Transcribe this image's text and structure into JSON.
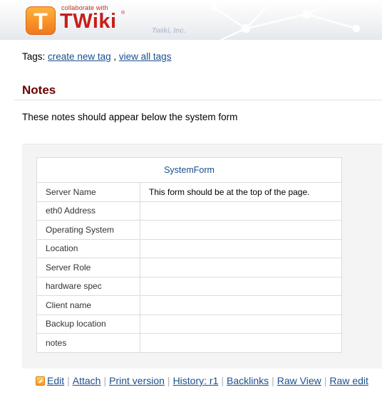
{
  "header": {
    "logo_letter": "T",
    "logo_tagline": "collaborate with",
    "logo_word": "TWiki",
    "logo_reg": "®",
    "company": "Twiki, Inc."
  },
  "tags": {
    "label": "Tags:",
    "create_new": "create new tag",
    "separator": ",",
    "view_all": "view all tags"
  },
  "notes": {
    "heading": "Notes",
    "text": "These notes should appear below the system form"
  },
  "system_form": {
    "title": "SystemForm",
    "rows": [
      {
        "name": "Server Name",
        "value": "This form should be at the top of the page."
      },
      {
        "name": "eth0 Address",
        "value": ""
      },
      {
        "name": "Operating System",
        "value": ""
      },
      {
        "name": "Location",
        "value": ""
      },
      {
        "name": "Server Role",
        "value": ""
      },
      {
        "name": "hardware spec",
        "value": ""
      },
      {
        "name": "Client name",
        "value": ""
      },
      {
        "name": "Backup location",
        "value": ""
      },
      {
        "name": "notes",
        "value": ""
      }
    ]
  },
  "actions": {
    "edit": "Edit",
    "attach": "Attach",
    "print": "Print version",
    "history": "History: r1",
    "backlinks": "Backlinks",
    "raw_view": "Raw View",
    "raw_edit": "Raw edit"
  },
  "colors": {
    "heading": "#6b0000",
    "link": "#1b4f8f",
    "logo_red": "#c61f1a",
    "logo_orange": "#f0781c"
  }
}
